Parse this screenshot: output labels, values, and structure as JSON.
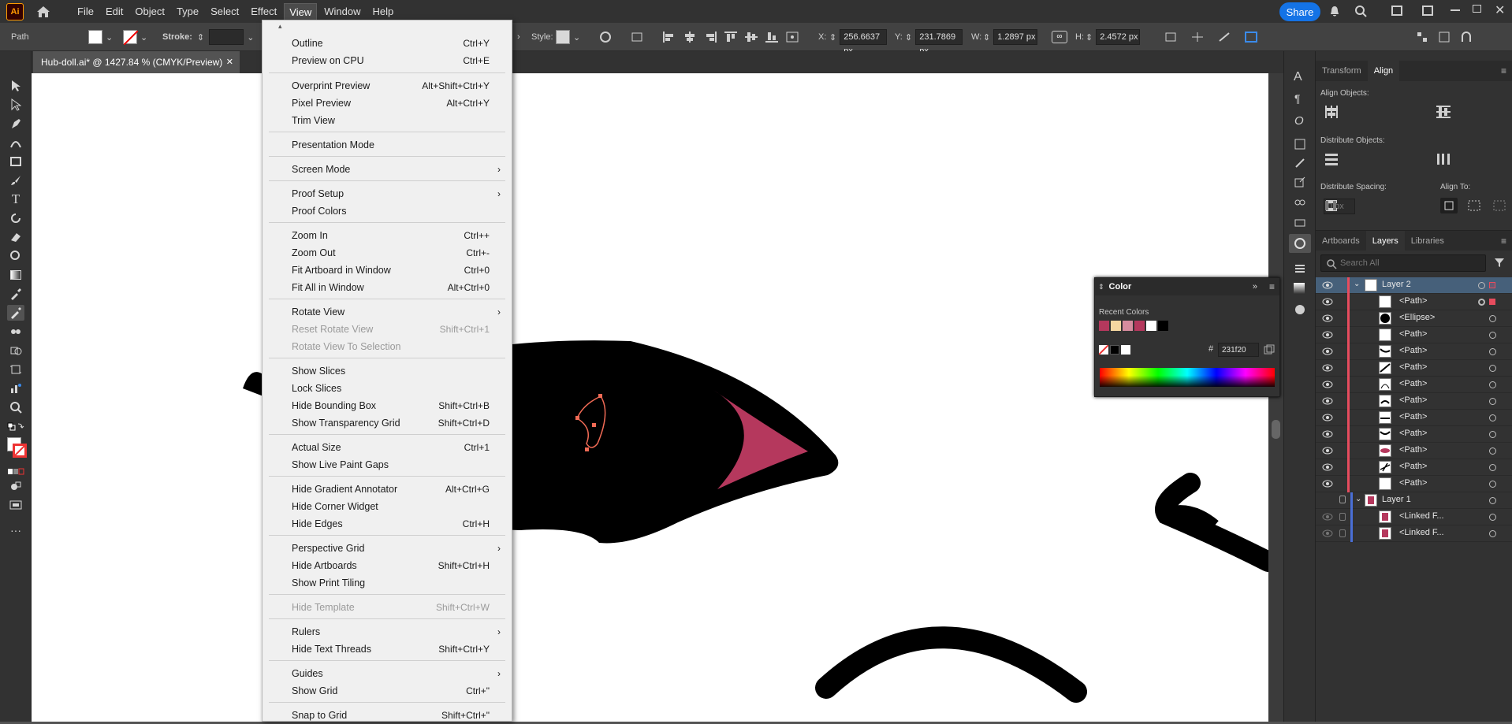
{
  "app": {
    "logo": "Ai",
    "share_label": "Share"
  },
  "menu": [
    "File",
    "Edit",
    "Object",
    "Type",
    "Select",
    "Effect",
    "View",
    "Window",
    "Help"
  ],
  "control": {
    "selection_type": "Path",
    "stroke_label": "Stroke:",
    "style_label": "Style:",
    "x_label": "X:",
    "x": "256.6637 px",
    "y_label": "Y:",
    "y": "231.7869 px",
    "w_label": "W:",
    "w": "1.2897 px",
    "h_label": "H:",
    "h": "2.4572 px"
  },
  "doc": {
    "tab_title": "Hub-doll.ai* @ 1427.84 % (CMYK/Preview)"
  },
  "view_menu": [
    {
      "label": "Outline",
      "shortcut": "Ctrl+Y"
    },
    {
      "label": "Preview on CPU",
      "shortcut": "Ctrl+E"
    },
    {
      "label": "Overprint Preview",
      "shortcut": "Alt+Shift+Ctrl+Y"
    },
    {
      "label": "Pixel Preview",
      "shortcut": "Alt+Ctrl+Y"
    },
    {
      "label": "Trim View",
      "shortcut": ""
    },
    {
      "label": "Presentation Mode",
      "shortcut": ""
    },
    {
      "label": "Screen Mode",
      "shortcut": ""
    },
    {
      "label": "Proof Setup",
      "shortcut": ""
    },
    {
      "label": "Proof Colors",
      "shortcut": ""
    },
    {
      "label": "Zoom In",
      "shortcut": "Ctrl++"
    },
    {
      "label": "Zoom Out",
      "shortcut": "Ctrl+-"
    },
    {
      "label": "Fit Artboard in Window",
      "shortcut": "Ctrl+0"
    },
    {
      "label": "Fit All in Window",
      "shortcut": "Alt+Ctrl+0"
    },
    {
      "label": "Rotate View",
      "shortcut": ""
    },
    {
      "label": "Reset Rotate View",
      "shortcut": "Shift+Ctrl+1"
    },
    {
      "label": "Rotate View To Selection",
      "shortcut": ""
    },
    {
      "label": "Show Slices",
      "shortcut": ""
    },
    {
      "label": "Lock Slices",
      "shortcut": ""
    },
    {
      "label": "Hide Bounding Box",
      "shortcut": "Shift+Ctrl+B"
    },
    {
      "label": "Show Transparency Grid",
      "shortcut": "Shift+Ctrl+D"
    },
    {
      "label": "Actual Size",
      "shortcut": "Ctrl+1"
    },
    {
      "label": "Show Live Paint Gaps",
      "shortcut": ""
    },
    {
      "label": "Hide Gradient Annotator",
      "shortcut": "Alt+Ctrl+G"
    },
    {
      "label": "Hide Corner Widget",
      "shortcut": ""
    },
    {
      "label": "Hide Edges",
      "shortcut": "Ctrl+H"
    },
    {
      "label": "Perspective Grid",
      "shortcut": ""
    },
    {
      "label": "Hide Artboards",
      "shortcut": "Shift+Ctrl+H"
    },
    {
      "label": "Show Print Tiling",
      "shortcut": ""
    },
    {
      "label": "Hide Template",
      "shortcut": "Shift+Ctrl+W"
    },
    {
      "label": "Rulers",
      "shortcut": ""
    },
    {
      "label": "Hide Text Threads",
      "shortcut": "Shift+Ctrl+Y"
    },
    {
      "label": "Guides",
      "shortcut": ""
    },
    {
      "label": "Show Grid",
      "shortcut": "Ctrl+\""
    },
    {
      "label": "Snap to Grid",
      "shortcut": "Shift+Ctrl+\""
    }
  ],
  "align_panel": {
    "tabs": [
      "Transform",
      "Align"
    ],
    "align_objects": "Align Objects:",
    "distribute_objects": "Distribute Objects:",
    "distribute_spacing": "Distribute Spacing:",
    "align_to": "Align To:",
    "spacing_value": "0 px"
  },
  "layers_panel": {
    "tabs": [
      "Artboards",
      "Layers",
      "Libraries"
    ],
    "search_placeholder": "Search All",
    "rows": [
      "Layer 2",
      "<Path>",
      "<Ellipse>",
      "<Path>",
      "<Path>",
      "<Path>",
      "<Path>",
      "<Path>",
      "<Path>",
      "<Path>",
      "<Path>",
      "<Path>",
      "<Path>",
      "Layer 1",
      "<Linked F...",
      "<Linked F..."
    ]
  },
  "color_panel": {
    "title": "Color",
    "recent_label": "Recent Colors",
    "hex_symbol": "#",
    "hex": "231f20",
    "recent_colors": [
      "#b5385d",
      "#f5d7a1",
      "#d68c9e",
      "#b5385d",
      "#ffffff",
      "#000000"
    ]
  },
  "colors": {
    "accent": "#1473e6",
    "pink": "#b5385d",
    "selection": "#46607a"
  }
}
